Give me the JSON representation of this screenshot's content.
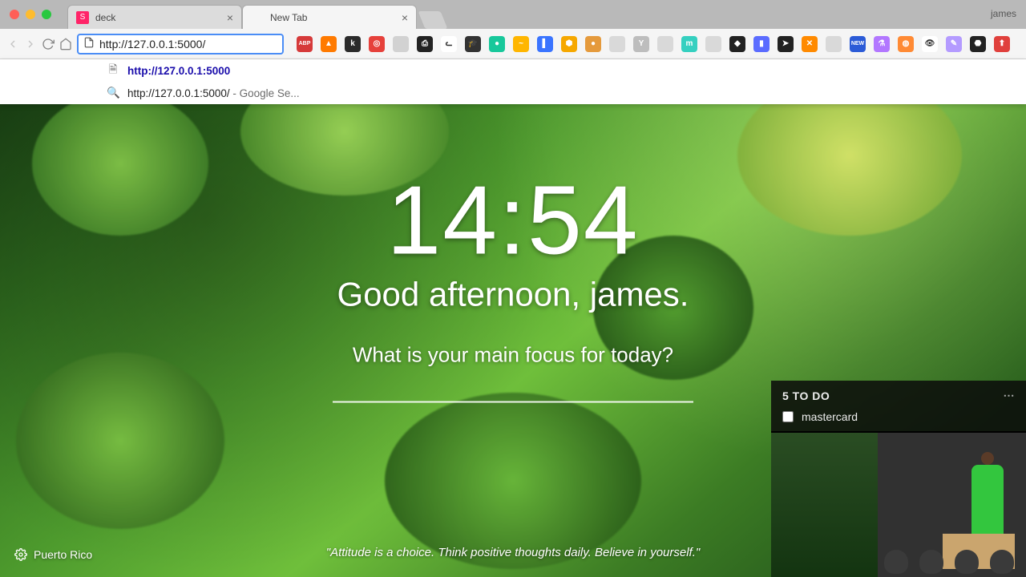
{
  "chrome": {
    "profile": "james",
    "tabs": [
      {
        "title": "deck",
        "favicon_bg": "#ff2468",
        "favicon_txt": "S",
        "active": false
      },
      {
        "title": "New Tab",
        "favicon_bg": "transparent",
        "favicon_txt": "",
        "active": true
      }
    ],
    "address_value": "http://127.0.0.1:5000/",
    "omnibox": {
      "suggestion_url": "http://127.0.0.1:5000",
      "search_text": "http://127.0.0.1:5000/",
      "search_suffix": " - Google Se..."
    }
  },
  "extensions": [
    {
      "name": "adblock",
      "bg": "#d63a3a",
      "txt": "ABP"
    },
    {
      "name": "flame",
      "bg": "#ff7a00",
      "txt": "▲"
    },
    {
      "name": "k-ext",
      "bg": "#2b2b2b",
      "txt": "k"
    },
    {
      "name": "noscript",
      "bg": "#e6413b",
      "txt": "◎"
    },
    {
      "name": "gray1",
      "bg": "#d2d2d2",
      "txt": ""
    },
    {
      "name": "print",
      "bg": "#222",
      "txt": "⎙"
    },
    {
      "name": "cat",
      "bg": "#ffffff",
      "txt": "ᓚ"
    },
    {
      "name": "grad",
      "bg": "#333",
      "txt": "🎓"
    },
    {
      "name": "teal-dot",
      "bg": "#18c89b",
      "txt": "●"
    },
    {
      "name": "wave",
      "bg": "#ffb600",
      "txt": "~"
    },
    {
      "name": "badge",
      "bg": "#3a74ff",
      "txt": "▌"
    },
    {
      "name": "honey",
      "bg": "#f6a800",
      "txt": "⬢"
    },
    {
      "name": "cookie",
      "bg": "#e59a3c",
      "txt": "●"
    },
    {
      "name": "ghost1",
      "bg": "#d9d9d9",
      "txt": ""
    },
    {
      "name": "y",
      "bg": "#bdbdbd",
      "txt": "Y"
    },
    {
      "name": "ghost2",
      "bg": "#d9d9d9",
      "txt": ""
    },
    {
      "name": "m-circle",
      "bg": "#35d0c0",
      "txt": "m"
    },
    {
      "name": "ghost3",
      "bg": "#d9d9d9",
      "txt": ""
    },
    {
      "name": "stack",
      "bg": "#222",
      "txt": "◆"
    },
    {
      "name": "col",
      "bg": "#5b6cff",
      "txt": "▮"
    },
    {
      "name": "send",
      "bg": "#222",
      "txt": "➤"
    },
    {
      "name": "x-orange",
      "bg": "#ff8a00",
      "txt": "✕"
    },
    {
      "name": "ghost4",
      "bg": "#d9d9d9",
      "txt": ""
    },
    {
      "name": "new",
      "bg": "#2b5bd7",
      "txt": "NEW"
    },
    {
      "name": "flask",
      "bg": "#b277ff",
      "txt": "⚗"
    },
    {
      "name": "planet",
      "bg": "#ff8a34",
      "txt": "◍"
    },
    {
      "name": "eye",
      "bg": "#ffffff",
      "txt": "👁"
    },
    {
      "name": "feather",
      "bg": "#b49bff",
      "txt": "✎"
    },
    {
      "name": "mask",
      "bg": "#222",
      "txt": "⬣"
    },
    {
      "name": "red-up",
      "bg": "#e0403c",
      "txt": "⬆"
    }
  ],
  "momentum": {
    "time": "14:54",
    "greeting": "Good afternoon, james.",
    "focus_prompt": "What is your main focus for today?",
    "quote": "\"Attitude is a choice. Think positive thoughts daily. Believe in yourself.\"",
    "location": "Puerto Rico",
    "todo": {
      "title": "5 TO DO",
      "items": [
        "mastercard"
      ]
    }
  }
}
